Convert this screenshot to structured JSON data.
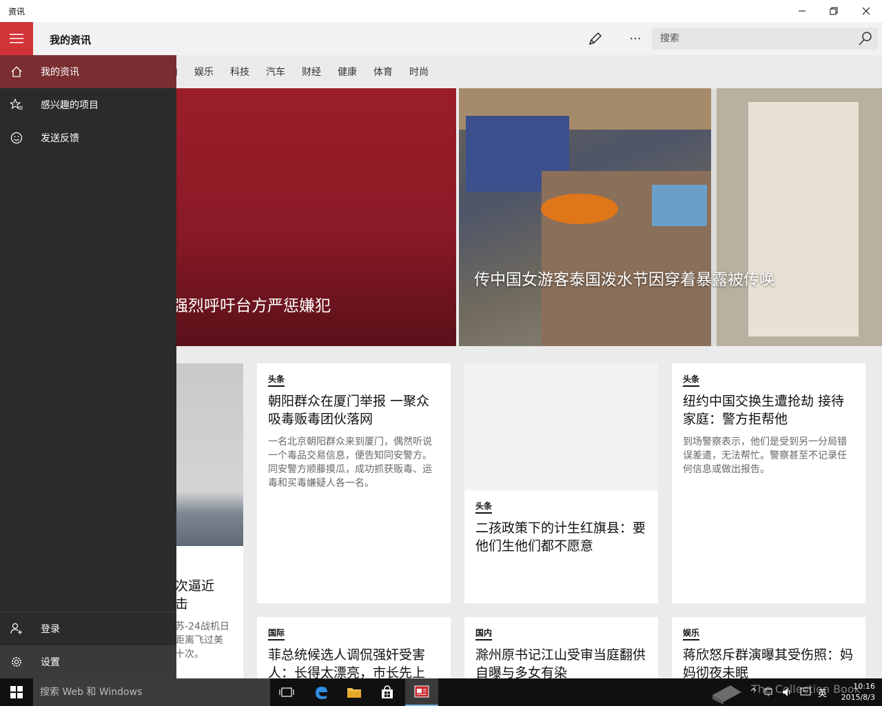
{
  "window": {
    "title": "资讯"
  },
  "header": {
    "app_title": "我的资讯",
    "search_placeholder": "搜索",
    "more_label": "···"
  },
  "tabs": [
    "国内",
    "娱乐",
    "科技",
    "汽车",
    "财经",
    "健康",
    "体育",
    "时尚"
  ],
  "sidebar": {
    "items": [
      {
        "label": "我的资讯",
        "icon": "home-icon"
      },
      {
        "label": "感兴趣的项目",
        "icon": "star-list-icon"
      },
      {
        "label": "发送反馈",
        "icon": "smiley-icon"
      }
    ],
    "bottom": [
      {
        "label": "登录",
        "icon": "person-add-icon"
      },
      {
        "label": "设置",
        "icon": "gear-icon"
      }
    ]
  },
  "hero": {
    "left_headline": "强烈呼吁台方严惩嫌犯",
    "right_headline": "传中国女游客泰国泼水节因穿着暴露被传唤"
  },
  "partial_card": {
    "title_line1": "次逼近",
    "title_line2": "击",
    "summary_line1": "苏-24战机日",
    "summary_line2": "距离飞过美",
    "summary_line3": "十次。"
  },
  "cards": [
    {
      "tag": "头条",
      "title": "朝阳群众在厦门举报 一聚众吸毒贩毒团伙落网",
      "summary": "一名北京朝阳群众来到厦门，偶然听说一个毒品交易信息，便告知同安警方。同安警方顺藤摸瓜，成功抓获贩毒、运毒和买毒嫌疑人各一名。"
    },
    {
      "tag": "头条",
      "title": "二孩政策下的计生红旗县：要他们生他们都不愿意",
      "summary": ""
    },
    {
      "tag": "头条",
      "title": "纽约中国交换生遭抢劫 接待家庭：警方拒帮他",
      "summary": "到场警察表示，他们是受到另一分局错误差遣，无法帮忙。警察甚至不记录任何信息或做出报告。"
    },
    {
      "tag": "国际",
      "title": "菲总统候选人调侃强奸受害人：长得太漂亮，市长先上",
      "summary": ""
    },
    {
      "tag": "国内",
      "title": "滁州原书记江山受审当庭翻供 自曝与多女有染",
      "summary": ""
    },
    {
      "tag": "娱乐",
      "title": "蒋欣怒斥群演曝其受伤照：妈妈彻夜未眠",
      "summary": ""
    }
  ],
  "taskbar": {
    "search_placeholder": "搜索 Web 和 Windows",
    "ime": "英",
    "time": "10:16",
    "date": "2015/8/3",
    "watermark": "The Collection Book"
  },
  "colors": {
    "accent": "#d13438",
    "sidebar_bg": "#2b2b2b",
    "active_item": "#7a2e31"
  }
}
